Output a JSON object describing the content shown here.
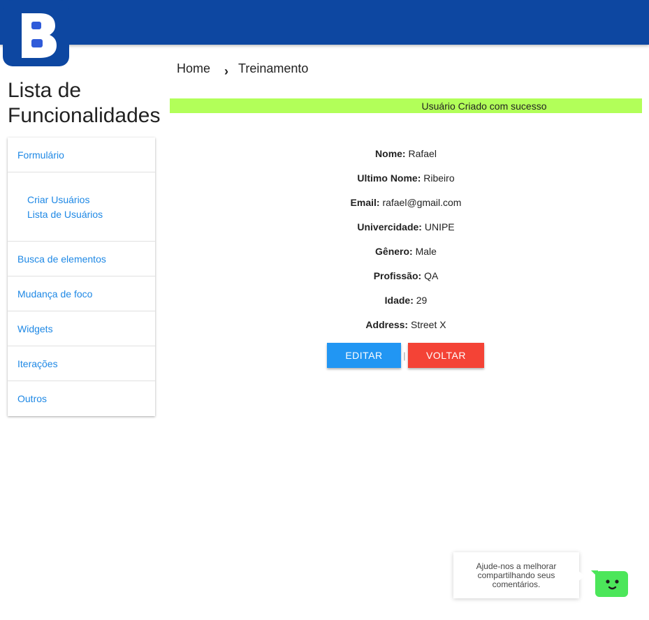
{
  "app": {
    "logo_letter": "B"
  },
  "breadcrumb": {
    "home": "Home",
    "separator": "›",
    "current": "Treinamento"
  },
  "page": {
    "title_line1": "Lista de",
    "title_line2": "Funcionalidades"
  },
  "sidebar": {
    "items": [
      {
        "label": "Formulário"
      },
      {
        "label": "Busca de elementos"
      },
      {
        "label": "Mudança de foco"
      },
      {
        "label": "Widgets"
      },
      {
        "label": "Iterações"
      },
      {
        "label": "Outros"
      }
    ],
    "subitems": [
      {
        "label": "Criar Usuários"
      },
      {
        "label": "Lista de Usuários"
      }
    ]
  },
  "alert": {
    "message": "Usuário Criado com sucesso",
    "color": "#b2ff59"
  },
  "user": {
    "fields": [
      {
        "label": "Nome:",
        "value": "Rafael"
      },
      {
        "label": "Ultimo Nome:",
        "value": "Ribeiro"
      },
      {
        "label": "Email:",
        "value": "rafael@gmail.com"
      },
      {
        "label": "Univercidade:",
        "value": "UNIPE"
      },
      {
        "label": "Gênero:",
        "value": "Male"
      },
      {
        "label": "Profissão:",
        "value": "QA"
      },
      {
        "label": "Idade:",
        "value": "29"
      },
      {
        "label": "Address:",
        "value": "Street X"
      }
    ]
  },
  "actions": {
    "edit_label": "EDITAR",
    "separator": "|",
    "back_label": "VOLTAR"
  },
  "feedback": {
    "message": "Ajude-nos a melhorar compartilhando seus comentários."
  },
  "colors": {
    "topbar": "#0d47a1",
    "link": "#1e88e5",
    "edit": "#2196f3",
    "back": "#f44336",
    "bot": "#4ce65a"
  },
  "icons": {
    "chevron": "chevron-right-icon",
    "bot": "smiley-bot-icon"
  }
}
